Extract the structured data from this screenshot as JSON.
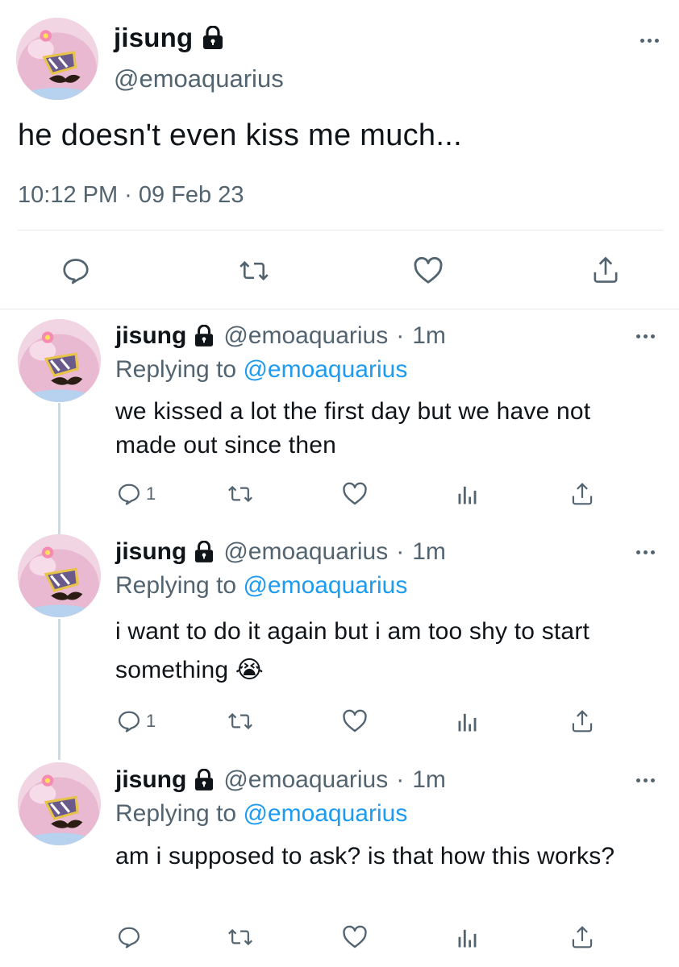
{
  "main_tweet": {
    "name": "jisung",
    "handle": "@emoaquarius",
    "text": "he doesn't even kiss me much...",
    "timestamp": "10:12 PM · 09 Feb 23",
    "actions": [
      "reply-icon",
      "retweet-icon",
      "like-icon",
      "share-icon"
    ]
  },
  "replies": [
    {
      "name": "jisung",
      "handle": "@emoaquarius",
      "dot": "·",
      "time": "1m",
      "replying_prefix": "Replying to",
      "replying_to": "@emoaquarius",
      "text": "we kissed a lot the first day but we have not made out since then",
      "reply_count": "1"
    },
    {
      "name": "jisung",
      "handle": "@emoaquarius",
      "dot": "·",
      "time": "1m",
      "replying_prefix": "Replying to",
      "replying_to": "@emoaquarius",
      "text": "i want to do it again but i am too shy to start something 😭",
      "reply_count": "1"
    },
    {
      "name": "jisung",
      "handle": "@emoaquarius",
      "dot": "·",
      "time": "1m",
      "replying_prefix": "Replying to",
      "replying_to": "@emoaquarius",
      "text": "am i supposed to ask? is that how this works?",
      "reply_count": ""
    }
  ],
  "colors": {
    "text": "#0f1419",
    "secondary": "#536471",
    "link": "#1d9bf0",
    "divider": "#e6e9eb",
    "thread_line": "#cfd9de"
  }
}
